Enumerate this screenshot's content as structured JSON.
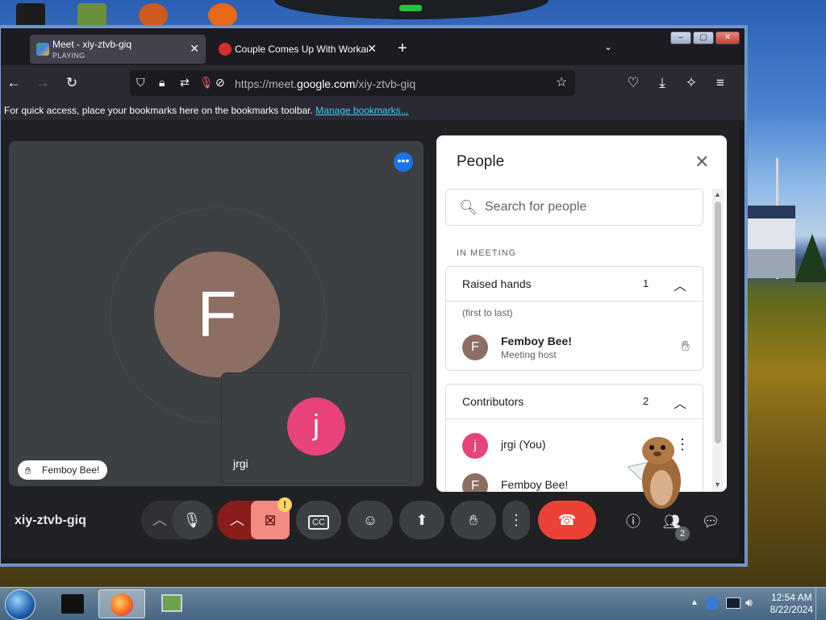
{
  "browser": {
    "tabs": [
      {
        "title": "Meet - xiy-ztvb-giq",
        "status": "PLAYING",
        "active": true
      },
      {
        "title": "Couple Comes Up With Workaround",
        "active": false
      }
    ],
    "new_tab": "+",
    "url_prefix": "https://meet.",
    "url_domain": "google.com",
    "url_path": "/xiy-ztvb-giq",
    "bookmarks_message": "For quick access, place your bookmarks here on the bookmarks toolbar.",
    "bookmarks_link": "Manage bookmarks..."
  },
  "meet": {
    "main_tile": {
      "initial": "F",
      "name_chip": "Femboy Bee!"
    },
    "self_tile": {
      "initial": "j",
      "name": "jrgi"
    },
    "meeting_code": "xiy-ztvb-giq",
    "camera_warning": "!",
    "people_badge": "2"
  },
  "people_panel": {
    "title": "People",
    "search_placeholder": "Search for people",
    "section_label": "IN MEETING",
    "raised_hands": {
      "label": "Raised hands",
      "count": "1",
      "note": "(first to last)",
      "people": [
        {
          "initial": "F",
          "name": "Femboy Bee!",
          "role": "Meeting host"
        }
      ]
    },
    "contributors": {
      "label": "Contributors",
      "count": "2",
      "people": [
        {
          "initial": "j",
          "name": "jrgi (You)"
        },
        {
          "initial": "F",
          "name": "Femboy Bee!"
        }
      ]
    }
  },
  "taskbar": {
    "time": "12:54 AM",
    "date": "8/22/2024"
  },
  "colors": {
    "meet_bg": "#202124",
    "tile_bg": "#3c4043",
    "accent_blue": "#1a73e8",
    "hangup_red": "#ea4335",
    "avatar_f": "#8d6e63",
    "avatar_j": "#e8437a"
  }
}
